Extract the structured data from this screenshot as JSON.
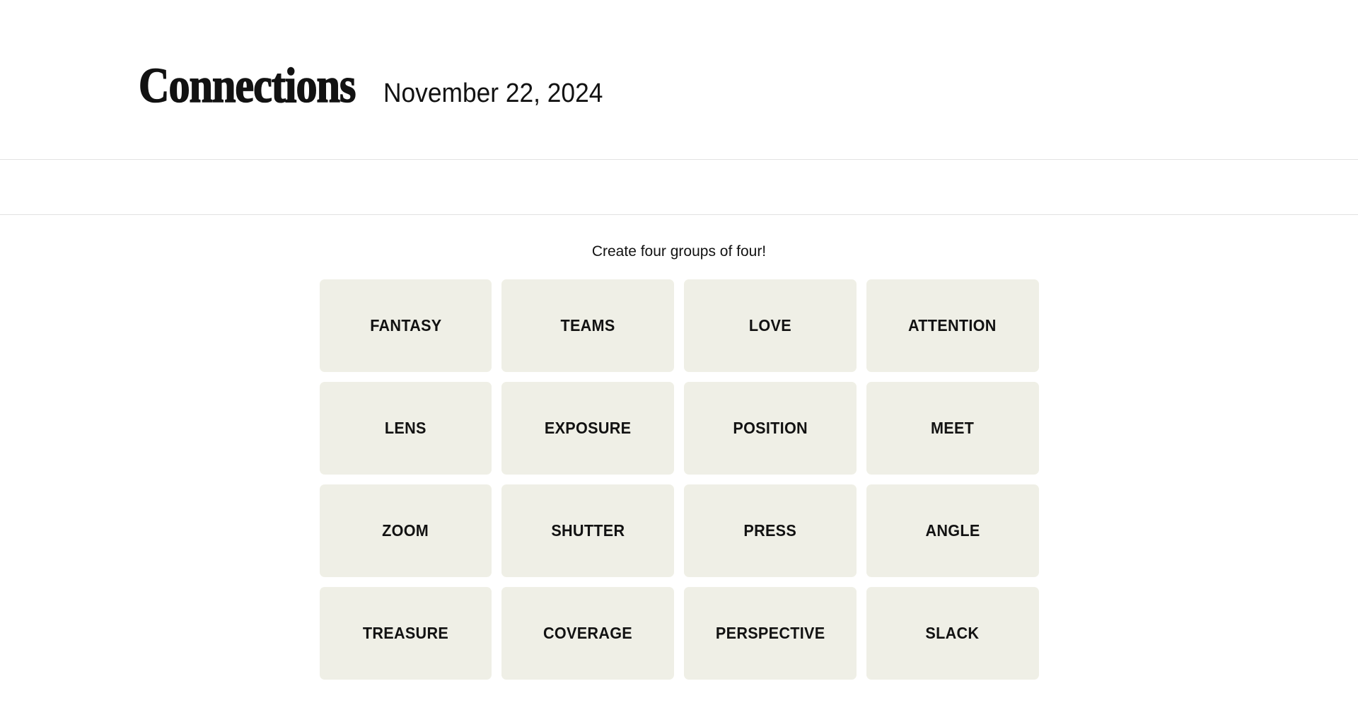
{
  "header": {
    "title": "Connections",
    "date": "November 22, 2024"
  },
  "toolbar": {
    "items": []
  },
  "puzzle": {
    "instructions": "Create four groups of four!",
    "tiles": [
      {
        "label": "FANTASY"
      },
      {
        "label": "TEAMS"
      },
      {
        "label": "LOVE"
      },
      {
        "label": "ATTENTION"
      },
      {
        "label": "LENS"
      },
      {
        "label": "EXPOSURE"
      },
      {
        "label": "POSITION"
      },
      {
        "label": "MEET"
      },
      {
        "label": "ZOOM"
      },
      {
        "label": "SHUTTER"
      },
      {
        "label": "PRESS"
      },
      {
        "label": "ANGLE"
      },
      {
        "label": "TREASURE"
      },
      {
        "label": "COVERAGE"
      },
      {
        "label": "PERSPECTIVE"
      },
      {
        "label": "SLACK"
      }
    ]
  },
  "colors": {
    "page_background": "#ffffff",
    "tile_background": "#efefe6",
    "text": "#121212",
    "rule": "#e2e2e2"
  }
}
